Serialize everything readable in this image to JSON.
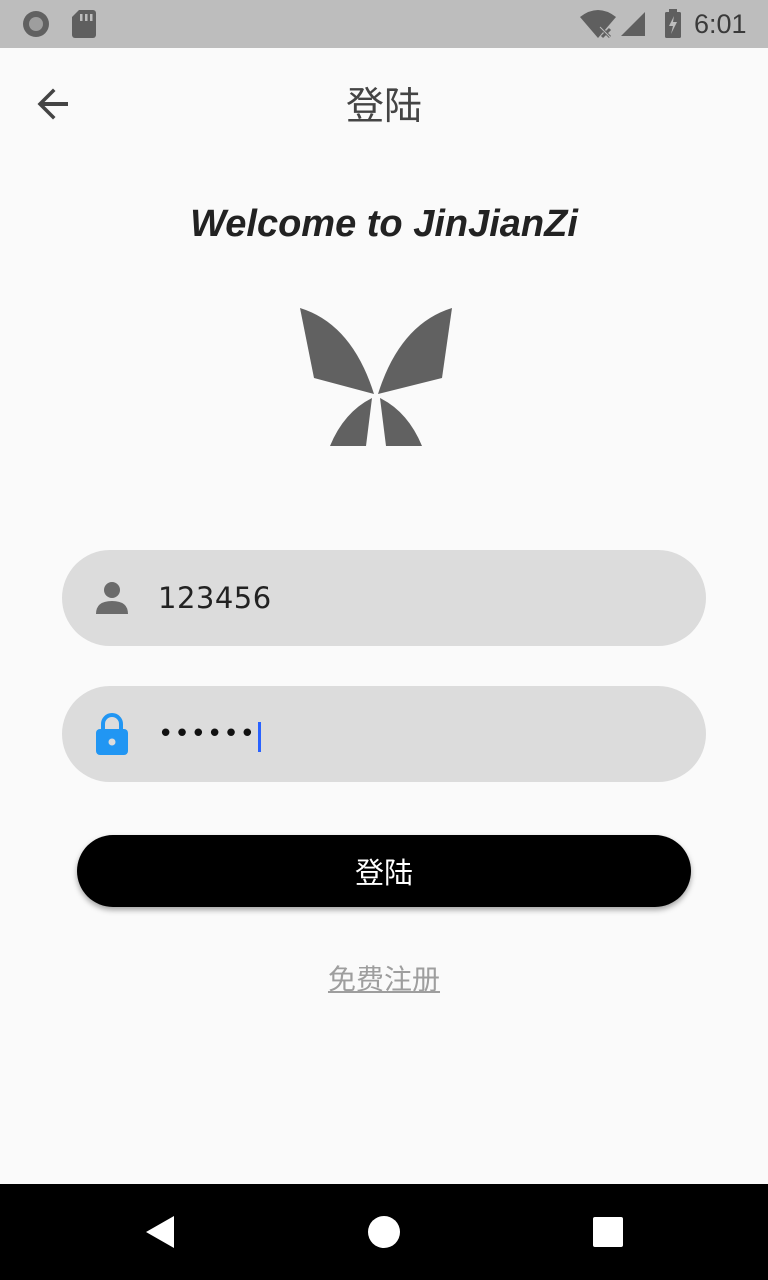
{
  "status_bar": {
    "time": "6:01",
    "icons": [
      "record-icon",
      "sd-card-icon",
      "wifi-off-icon",
      "signal-icon",
      "battery-charging-icon"
    ]
  },
  "app_bar": {
    "title": "登陆",
    "back_icon": "arrow-back-icon"
  },
  "welcome_text": "Welcome to JinJianZi",
  "logo_icon": "butterfly-logo-icon",
  "form": {
    "username": {
      "icon": "person-icon",
      "value": "123456"
    },
    "password": {
      "icon": "lock-icon",
      "value": "••••••"
    },
    "login_label": "登陆",
    "register_label": "免费注册"
  },
  "nav_bar": {
    "icons": [
      "nav-back-icon",
      "nav-home-icon",
      "nav-recent-icon"
    ]
  },
  "colors": {
    "status_bar": "#bdbdbd",
    "background": "#fafafa",
    "field": "#dcdcdc",
    "button": "#000000",
    "lock_accent": "#2196f3",
    "caret": "#2962ff",
    "link": "#9e9e9e"
  }
}
